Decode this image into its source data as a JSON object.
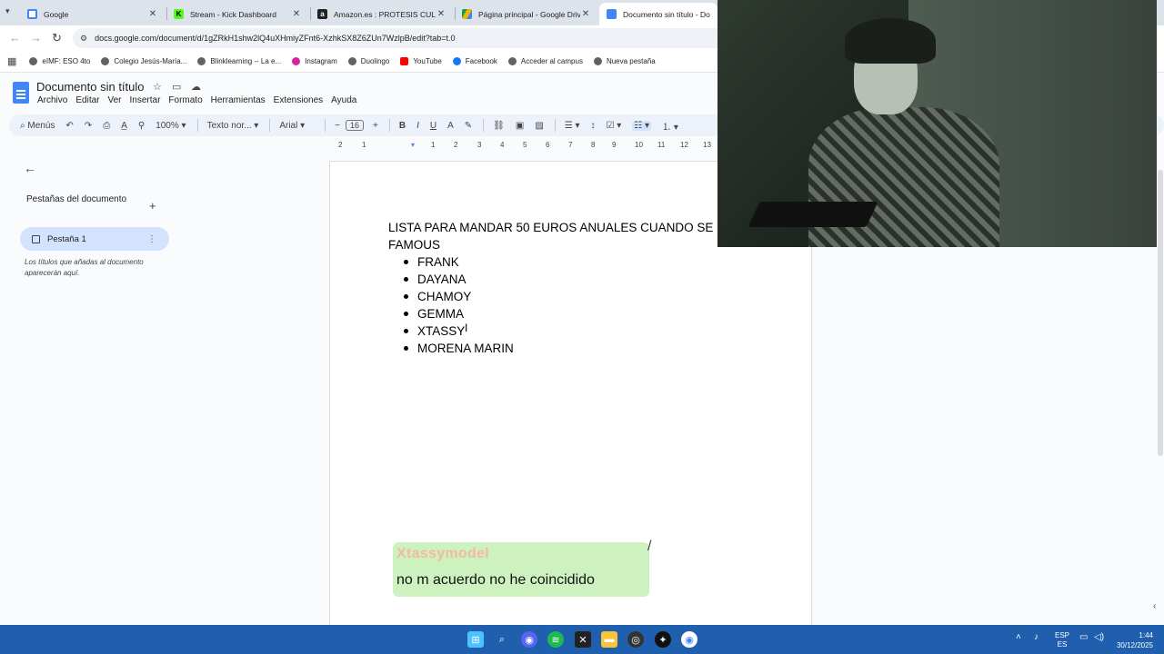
{
  "browser": {
    "tabs": [
      {
        "title": "Google",
        "favicon": "google-icon",
        "active": false
      },
      {
        "title": "Stream - Kick Dashboard",
        "favicon": "kick-icon",
        "active": false
      },
      {
        "title": "Amazon.es : PROTESIS CULO",
        "favicon": "amazon-icon",
        "active": false
      },
      {
        "title": "Página principal - Google Drive",
        "favicon": "drive-icon",
        "active": false
      },
      {
        "title": "Documento sin título - Docum",
        "favicon": "docs-icon",
        "active": true
      }
    ],
    "url": "docs.google.com/document/d/1gZRkH1shw2lQ4uXHmiyZFnt6-XzhkSX8Z6ZUn7WzlpB/edit?tab=t.0",
    "bookmarks": [
      "eIMF: ESO 4to",
      "Colegio Jesús-María...",
      "Blinklearning -- La e...",
      "Instagram",
      "Duolingo",
      "YouTube",
      "Facebook",
      "Acceder al campus",
      "Nueva pestaña"
    ]
  },
  "docs": {
    "title": "Documento sin título",
    "menu": [
      "Archivo",
      "Editar",
      "Ver",
      "Insertar",
      "Formato",
      "Herramientas",
      "Extensiones",
      "Ayuda"
    ],
    "toolbar": {
      "menus_label": "Menús",
      "zoom": "100%",
      "style": "Texto nor...",
      "font": "Arial",
      "font_size": "16"
    },
    "ruler_labels": [
      "2",
      "1",
      "1",
      "2",
      "3",
      "4",
      "5",
      "6",
      "7",
      "8",
      "9",
      "10",
      "11",
      "12",
      "13",
      "14"
    ],
    "sidebar": {
      "heading": "Pestañas del documento",
      "tab_label": "Pestaña 1",
      "hint": "Los títulos que añadas al documento aparecerán aquí."
    },
    "content": {
      "heading": "LISTA PARA MANDAR 50 EUROS ANUALES CUANDO SE\nFAMOUS",
      "list": [
        "FRANK",
        "DAYANA",
        "CHAMOY",
        "GEMMA",
        "XTASSY",
        "MORENA MARIN"
      ]
    }
  },
  "chat": {
    "username": "Xtassymodel",
    "message": "no m acuerdo no he coincidido"
  },
  "taskbar": {
    "lang_top": "ESP",
    "lang_bottom": "ES",
    "time": "1:44",
    "date": "30/12/2025"
  },
  "colors": {
    "chat_bg": "#cdf2c0",
    "chat_username": "#f6b9a0",
    "taskbar": "#1f5fae",
    "active_tab_bg": "#d3e3fd"
  }
}
